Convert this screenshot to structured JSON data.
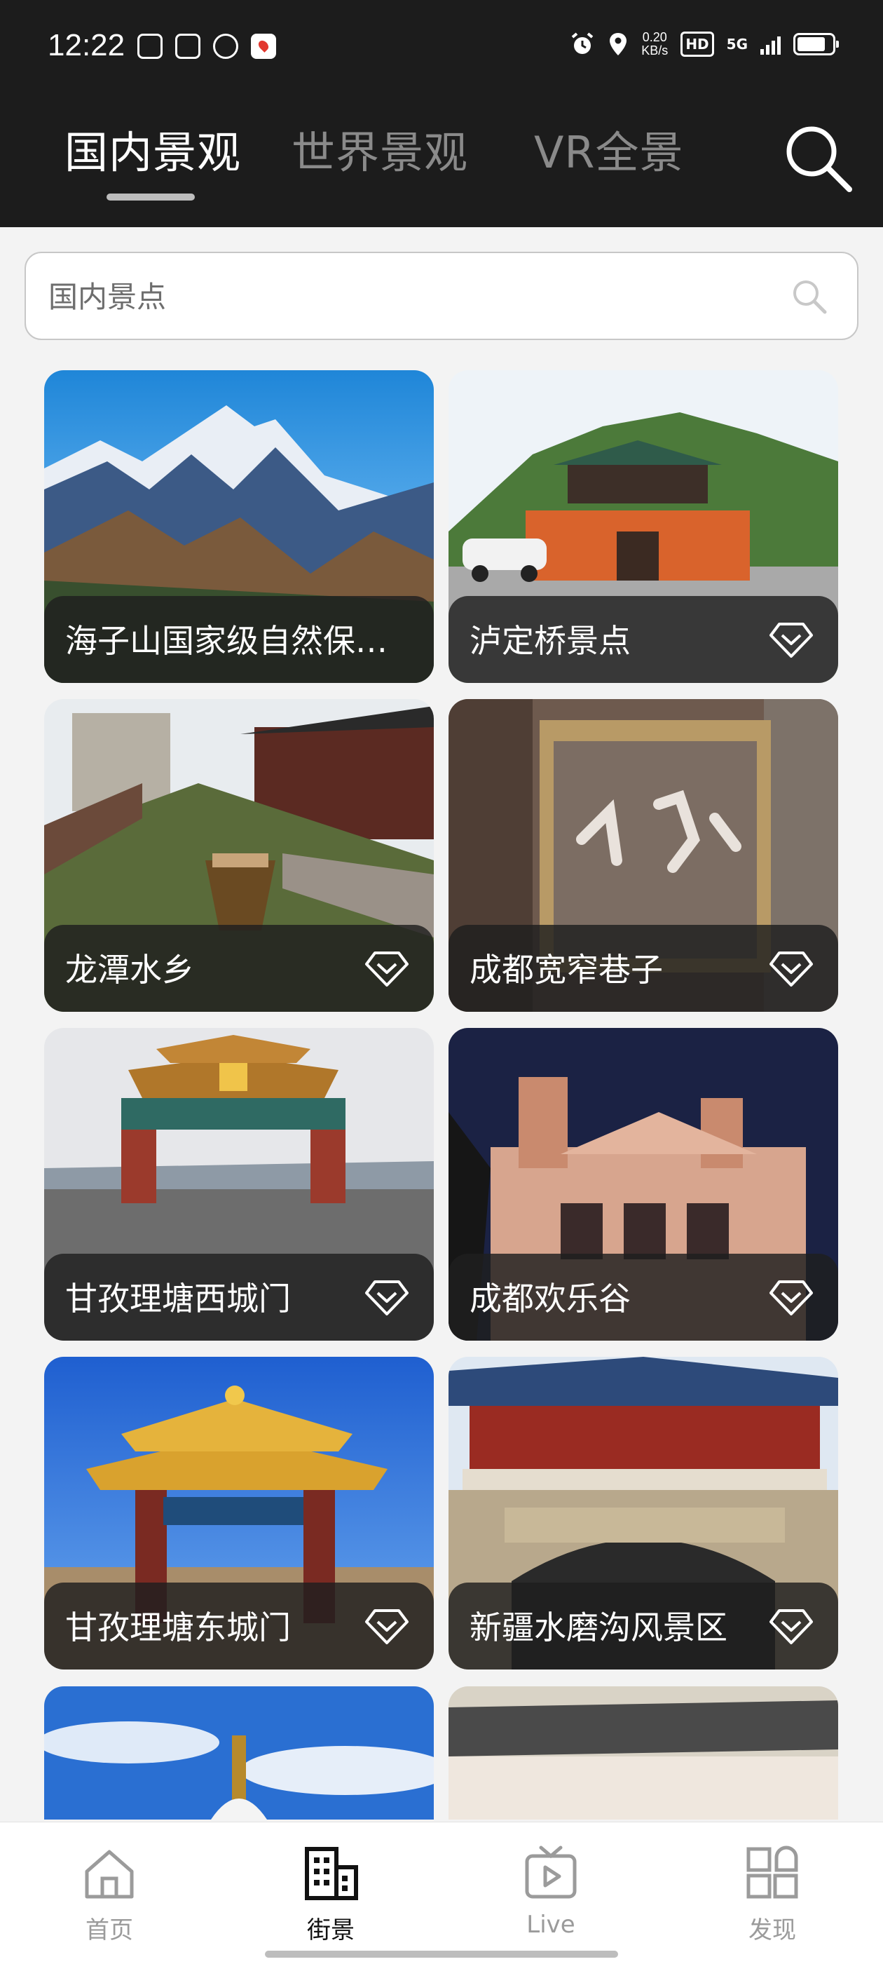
{
  "status_bar": {
    "time": "12:22",
    "net_speed_value": "0.20",
    "net_speed_unit": "KB/s",
    "hd_label": "HD",
    "network_label": "5G"
  },
  "tabs": [
    {
      "label": "国内景观",
      "active": true
    },
    {
      "label": "世界景观",
      "active": false
    },
    {
      "label": "VR全景",
      "active": false
    }
  ],
  "search": {
    "placeholder": "国内景点",
    "value": ""
  },
  "spots": [
    {
      "name": "海子山国家级自然保护区",
      "icon": "mountain-scene",
      "favorite_icon": false
    },
    {
      "name": "泸定桥景点",
      "icon": "temple-gate-scene",
      "favorite_icon": true
    },
    {
      "name": "龙潭水乡",
      "icon": "canal-scene",
      "favorite_icon": true
    },
    {
      "name": "成都宽窄巷子",
      "icon": "brick-wall-scene",
      "favorite_icon": true
    },
    {
      "name": "甘孜理塘西城门",
      "icon": "gate-scene",
      "favorite_icon": true
    },
    {
      "name": "成都欢乐谷",
      "icon": "night-building-scene",
      "favorite_icon": true
    },
    {
      "name": "甘孜理塘东城门",
      "icon": "golden-gate-scene",
      "favorite_icon": true
    },
    {
      "name": "新疆水磨沟风景区",
      "icon": "red-pavilion-scene",
      "favorite_icon": true
    }
  ],
  "bottom_nav": [
    {
      "label": "首页",
      "icon": "home-icon",
      "active": false
    },
    {
      "label": "街景",
      "icon": "buildings-icon",
      "active": true
    },
    {
      "label": "Live",
      "icon": "tv-play-icon",
      "active": false
    },
    {
      "label": "发现",
      "icon": "discover-grid-icon",
      "active": false
    }
  ],
  "colors": {
    "topbar": "#1c1c1c",
    "page_bg": "#f3f3f3",
    "caption_bg": "#1e1e1e",
    "tab_inactive": "#8a8a8a"
  }
}
